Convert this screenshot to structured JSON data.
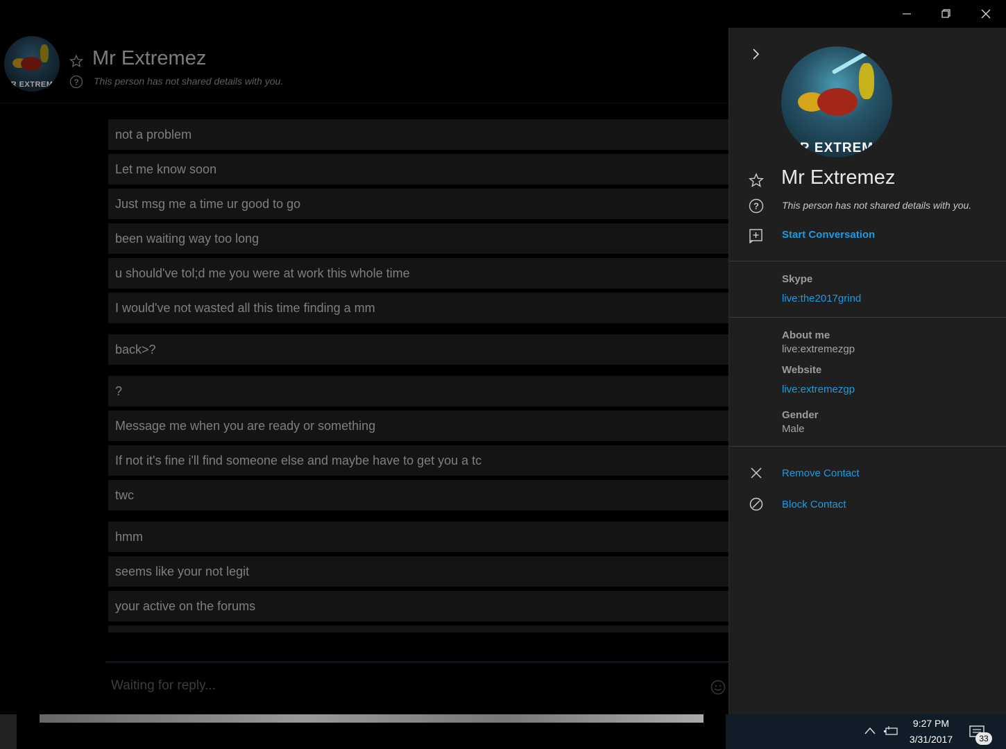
{
  "contact": {
    "name": "Mr Extremez",
    "status_text": "This person has not shared details with you.",
    "avatar_text": "R EXTREM"
  },
  "messages": [
    {
      "text": "not a problem",
      "tail": false
    },
    {
      "text": "Let me know soon",
      "tail": false
    },
    {
      "text": "Just msg me a time ur good to go",
      "tail": false
    },
    {
      "text": "been waiting way too long",
      "tail": false
    },
    {
      "text": "u should've tol;d me you were at work this whole time",
      "tail": false
    },
    {
      "text": "I would've not wasted all this time finding a mm",
      "tail": false
    },
    {
      "text": "back>?",
      "tail": true
    },
    {
      "text": "?",
      "tail": true
    },
    {
      "text": "Message me when you are ready or something",
      "tail": false
    },
    {
      "text": "If not it's fine i'll find someone else and maybe have to get you a tc",
      "tail": false
    },
    {
      "text": "twc",
      "tail": false
    },
    {
      "text": "hmm",
      "tail": true
    },
    {
      "text": "seems like your not legit",
      "tail": false
    },
    {
      "text": "your active on the forums",
      "tail": false
    }
  ],
  "compose": {
    "placeholder": "Waiting for reply..."
  },
  "panel": {
    "start_conversation": "Start Conversation",
    "skype_label": "Skype",
    "skype_value": "live:the2017grind",
    "about_label": "About me",
    "about_value": "live:extremezgp",
    "website_label": "Website",
    "website_value": "live:extremezgp",
    "gender_label": "Gender",
    "gender_value": "Male",
    "remove_contact": "Remove Contact",
    "block_contact": "Block Contact"
  },
  "taskbar": {
    "time": "9:27 PM",
    "date": "3/31/2017",
    "notification_count": "33"
  },
  "colors": {
    "accent": "#1e9be0",
    "panel_bg": "#1f1f1f",
    "bubble_bg": "#141414"
  }
}
